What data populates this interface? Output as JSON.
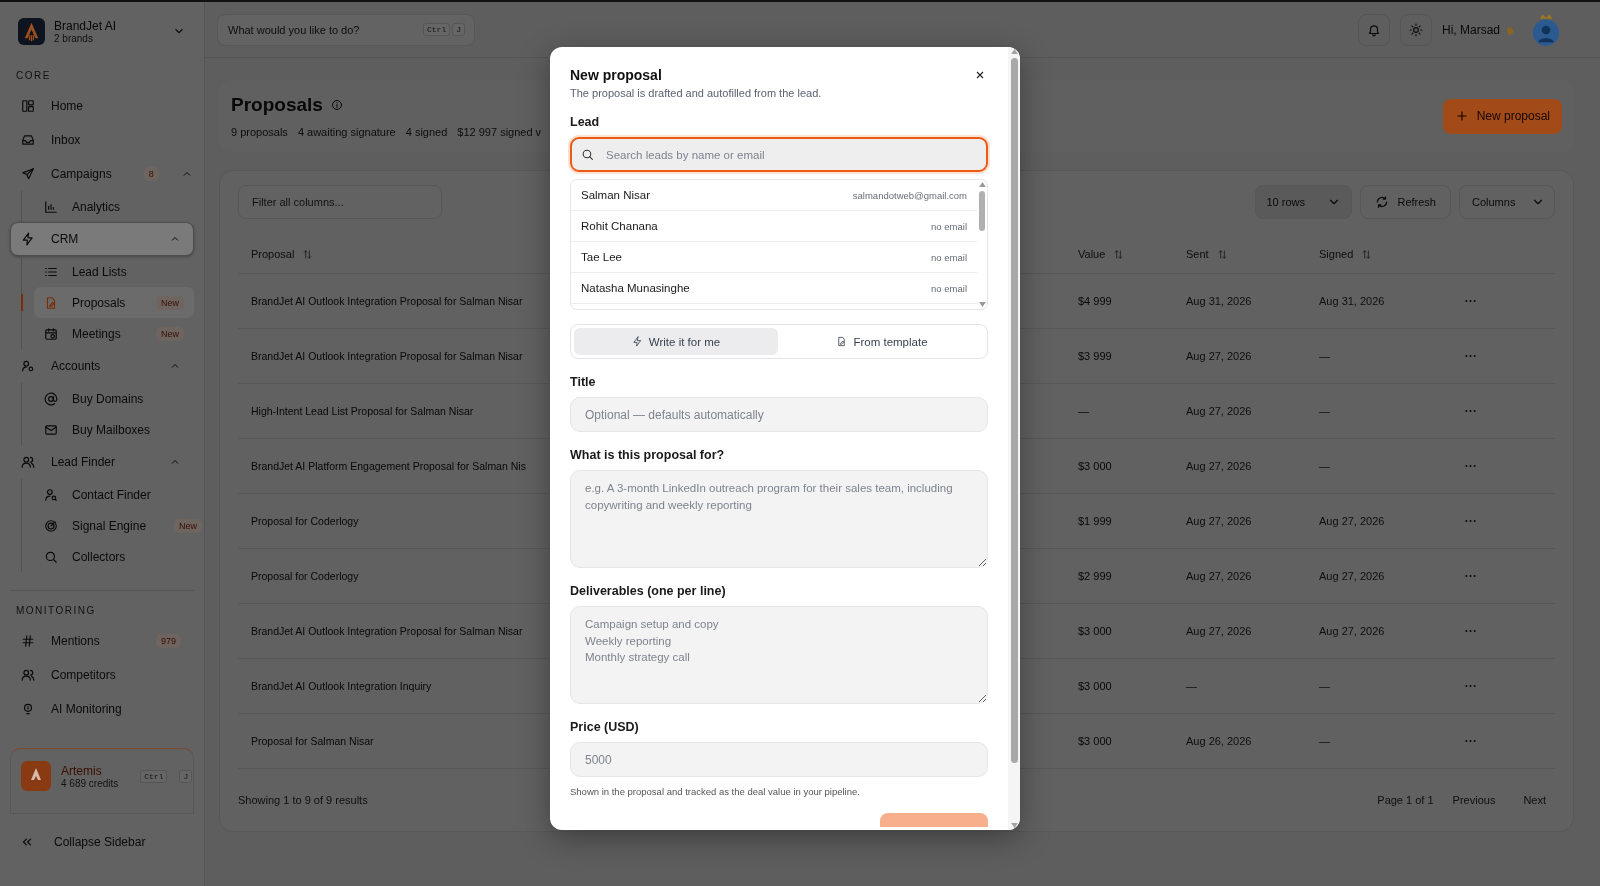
{
  "workspace": {
    "name": "BrandJet AI",
    "subtitle": "2 brands"
  },
  "sidebar": {
    "sections": [
      {
        "title": "CORE",
        "items": [
          {
            "label": "Home",
            "selected": false
          },
          {
            "label": "Inbox",
            "selected": false
          },
          {
            "label": "Campaigns",
            "badge": "8",
            "selected": false,
            "expanded": true,
            "children": [
              {
                "label": "Analytics",
                "selected": false
              }
            ]
          },
          {
            "label": "CRM",
            "selected": true,
            "expanded": true,
            "children": [
              {
                "label": "Lead Lists",
                "selected": false
              },
              {
                "label": "Proposals",
                "badge": "New",
                "selected": true
              },
              {
                "label": "Meetings",
                "badge": "New",
                "selected": false
              }
            ]
          },
          {
            "label": "Accounts",
            "selected": false,
            "expanded": true,
            "children": [
              {
                "label": "Buy Domains",
                "selected": false
              },
              {
                "label": "Buy Mailboxes",
                "selected": false
              }
            ]
          },
          {
            "label": "Lead Finder",
            "selected": false,
            "expanded": true,
            "children": [
              {
                "label": "Contact Finder",
                "selected": false
              },
              {
                "label": "Signal Engine",
                "badge": "New",
                "selected": false
              },
              {
                "label": "Collectors",
                "selected": false
              }
            ]
          }
        ]
      },
      {
        "title": "MONITORING",
        "items": [
          {
            "label": "Mentions",
            "badge": "979",
            "selected": false
          },
          {
            "label": "Competitors",
            "selected": false
          },
          {
            "label": "AI Monitoring",
            "selected": false
          }
        ]
      }
    ],
    "assistant": {
      "name": "Artemis",
      "credits": "4 689 credits",
      "shortcut": [
        "Ctrl",
        "J"
      ]
    },
    "collapse": "Collapse Sidebar"
  },
  "header": {
    "command_search": {
      "placeholder": "What would you like to do?",
      "shortcut": [
        "Ctrl",
        "J"
      ]
    },
    "greeting": "Hi, Marsad"
  },
  "page": {
    "title": "Proposals",
    "stats": [
      "9 proposals",
      "4 awaiting signature",
      "4 signed",
      "$12 997 signed v"
    ],
    "new_button": "New proposal"
  },
  "table": {
    "filter_placeholder": "Filter all columns...",
    "rows_select": "10 rows",
    "refresh": "Refresh",
    "columns_button": "Columns",
    "columns": [
      "Proposal",
      "Value",
      "Sent",
      "Signed"
    ],
    "rows": [
      {
        "proposal": "BrandJet AI Outlook Integration Proposal for Salman Nisar",
        "value": "$4 999",
        "sent": "Aug 31, 2026",
        "signed": "Aug 31, 2026"
      },
      {
        "proposal": "BrandJet AI Outlook Integration Proposal for Salman Nisar",
        "value": "$3 999",
        "sent": "Aug 27, 2026",
        "signed": "—"
      },
      {
        "proposal": "High-Intent Lead List Proposal for Salman Nisar",
        "value": "—",
        "sent": "Aug 27, 2026",
        "signed": "—"
      },
      {
        "proposal": "BrandJet AI Platform Engagement Proposal for Salman Nis",
        "value": "$3 000",
        "sent": "Aug 27, 2026",
        "signed": "—"
      },
      {
        "proposal": "Proposal for Coderlogy",
        "value": "$1 999",
        "sent": "Aug 27, 2026",
        "signed": "Aug 27, 2026"
      },
      {
        "proposal": "Proposal for Coderlogy",
        "value": "$2 999",
        "sent": "Aug 27, 2026",
        "signed": "Aug 27, 2026"
      },
      {
        "proposal": "BrandJet AI Outlook Integration Proposal for Salman Nisar",
        "value": "$3 000",
        "sent": "Aug 27, 2026",
        "signed": "Aug 27, 2026"
      },
      {
        "proposal": "BrandJet AI Outlook Integration Inquiry",
        "value": "$3 000",
        "sent": "—",
        "signed": "—"
      },
      {
        "proposal": "Proposal for Salman Nisar",
        "value": "$3 000",
        "sent": "Aug 26, 2026",
        "signed": "—"
      }
    ],
    "summary": "Showing 1 to 9 of 9 results",
    "page": "Page 1 of 1",
    "previous": "Previous",
    "next": "Next"
  },
  "modal": {
    "title": "New proposal",
    "subtitle": "The proposal is drafted and autofilled from the lead.",
    "lead_label": "Lead",
    "lead_search": {
      "placeholder": "Search leads by name or email",
      "focused": true
    },
    "leads": [
      {
        "name": "Salman Nisar",
        "email": "salmandotweb@gmail.com"
      },
      {
        "name": "Rohit Chanana",
        "email": "no email"
      },
      {
        "name": "Tae Lee",
        "email": "no email"
      },
      {
        "name": "Natasha Munasinghe",
        "email": "no email"
      }
    ],
    "modes": [
      {
        "label": "Write it for me",
        "selected": true
      },
      {
        "label": "From template",
        "selected": false
      }
    ],
    "fields": [
      {
        "kind": "input",
        "label": "Title",
        "placeholder": "Optional — defaults automatically"
      },
      {
        "kind": "textarea",
        "label": "What is this proposal for?",
        "placeholder": "e.g. A 3-month LinkedIn outreach program for their sales team, including copywriting and weekly reporting"
      },
      {
        "kind": "textarea",
        "label": "Deliverables (one per line)",
        "placeholder": "Campaign setup and copy\nWeekly reporting\nMonthly strategy call"
      },
      {
        "kind": "input",
        "label": "Price (USD)",
        "placeholder": "5000",
        "hint": "Shown in the proposal and tracked as the deal value in your pipeline."
      }
    ]
  }
}
